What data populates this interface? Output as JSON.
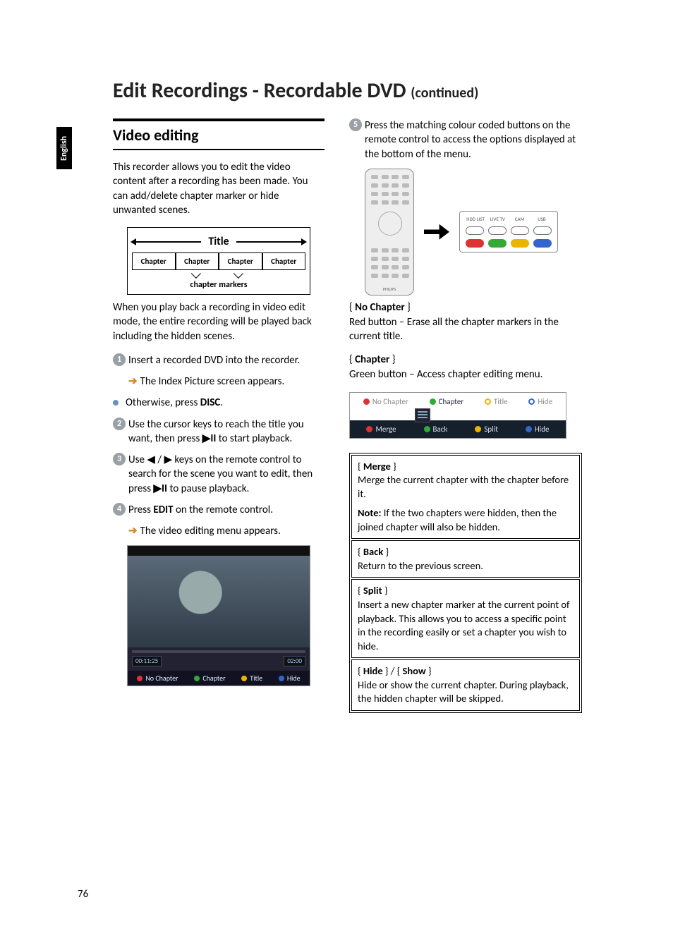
{
  "page": {
    "title_main": "Edit Recordings - Recordable DVD ",
    "title_suffix": "(continued)",
    "side_tab": "English",
    "page_number": "76"
  },
  "left": {
    "heading": "Video editing",
    "intro": "This recorder allows you to edit the video content after a recording has been made. You can add/delete chapter marker or hide unwanted scenes.",
    "diagram": {
      "title": "Title",
      "chapter": "Chapter",
      "markers_label": "chapter markers"
    },
    "para2": "When you play back a recording in video edit mode, the entire recording will be played back including the hidden scenes.",
    "step1": "Insert a recorded DVD into the recorder.",
    "step1_sub": "The Index Picture screen appears.",
    "bullet_disc_pre": "Otherwise, press ",
    "bullet_disc_bold": "DISC",
    "bullet_disc_post": ".",
    "step2_pre": "Use the cursor keys to reach the title you want, then press ",
    "step2_icon": "▶II",
    "step2_post": " to start playback.",
    "step3_pre": "Use ",
    "step3_keys": "◀ / ▶",
    "step3_mid": " keys on the remote control to search for the scene you want to edit, then press ",
    "step3_icon": "▶II",
    "step3_post": " to pause playback.",
    "step4_pre": "Press ",
    "step4_bold": "EDIT",
    "step4_post": " on the remote control.",
    "step4_sub": "The video editing menu appears.",
    "ves": {
      "time_left": "00:11:25",
      "time_right": "02:00",
      "items": [
        "No Chapter",
        "Chapter",
        "Title",
        "Hide"
      ]
    }
  },
  "right": {
    "step5": "Press the matching colour coded buttons on the remote control to access the options displayed at the bottom of the menu.",
    "color_panel_labels": [
      "HDD LIST",
      "LIVE TV",
      "CAM",
      "USB"
    ],
    "remote_brand": "PHILIPS",
    "no_chapter_label": "{ No Chapter }",
    "no_chapter_desc": "Red button – Erase all the chapter markers in the current title.",
    "chapter_label": "{ Chapter }",
    "chapter_desc": "Green button – Access chapter editing menu.",
    "submenu_top": {
      "no_chapter": "No Chapter",
      "chapter": "Chapter",
      "title": "Title",
      "hide": "Hide"
    },
    "submenu_bottom": {
      "merge": "Merge",
      "back": "Back",
      "split": "Split",
      "hide": "Hide"
    },
    "table": {
      "merge_label": "{ Merge }",
      "merge_desc": "Merge the current chapter with the chapter before it.",
      "merge_note_pre": "Note:",
      "merge_note": " If the two chapters were hidden, then the joined chapter will also be hidden.",
      "back_label": "{ Back }",
      "back_desc": "Return to the previous screen.",
      "split_label": "{ Split }",
      "split_desc": "Insert a new chapter marker at the current point of playback. This allows you to access a specific point in the recording easily or set a chapter you wish to hide.",
      "hide_label": "{ Hide } / { Show }",
      "hide_desc": "Hide or show the current chapter. During playback, the hidden chapter will be skipped."
    }
  }
}
